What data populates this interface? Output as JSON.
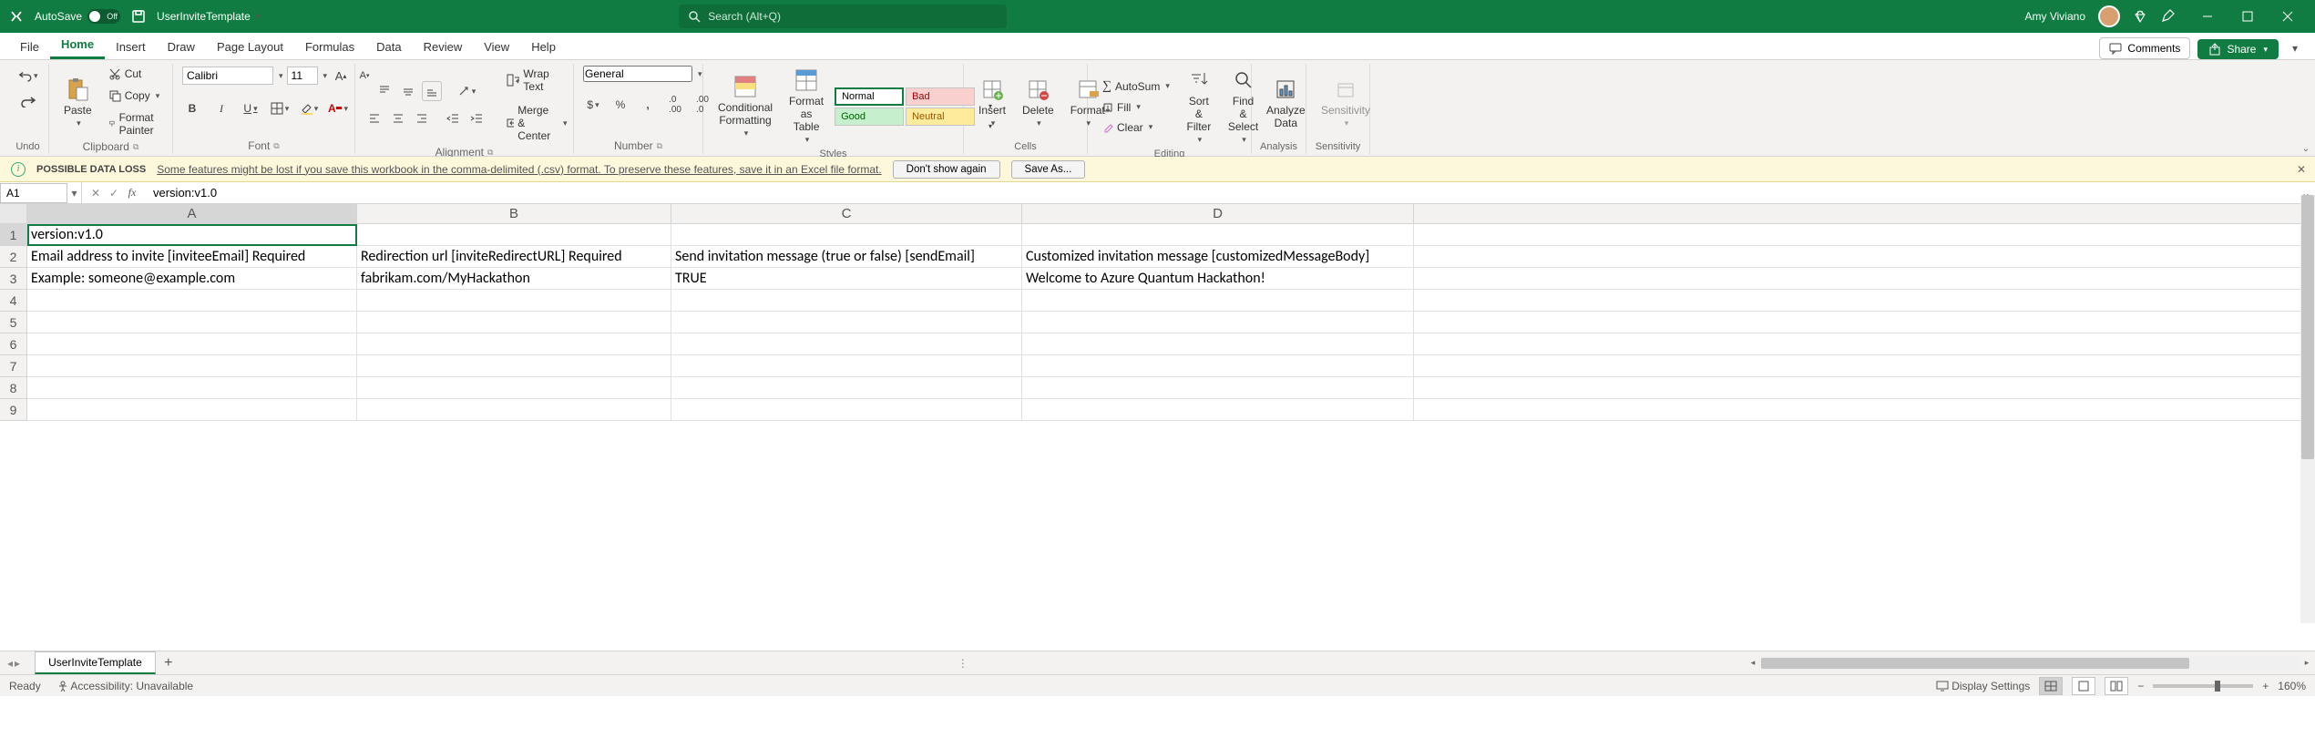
{
  "titlebar": {
    "autosave_label": "AutoSave",
    "autosave_state": "Off",
    "filename": "UserInviteTemplate",
    "search_placeholder": "Search (Alt+Q)",
    "username": "Amy Viviano"
  },
  "tabs": {
    "file": "File",
    "home": "Home",
    "insert": "Insert",
    "draw": "Draw",
    "page_layout": "Page Layout",
    "formulas": "Formulas",
    "data": "Data",
    "review": "Review",
    "view": "View",
    "help": "Help",
    "comments": "Comments",
    "share": "Share"
  },
  "ribbon": {
    "undo_label": "Undo",
    "paste": "Paste",
    "cut": "Cut",
    "copy": "Copy",
    "format_painter": "Format Painter",
    "clipboard_label": "Clipboard",
    "font_name": "Calibri",
    "font_size": "11",
    "font_label": "Font",
    "wrap_text": "Wrap Text",
    "merge_center": "Merge & Center",
    "alignment_label": "Alignment",
    "number_format": "General",
    "number_label": "Number",
    "conditional_formatting": "Conditional\nFormatting",
    "format_as_table": "Format as\nTable",
    "style_normal": "Normal",
    "style_bad": "Bad",
    "style_good": "Good",
    "style_neutral": "Neutral",
    "styles_label": "Styles",
    "insert_btn": "Insert",
    "delete_btn": "Delete",
    "format_btn": "Format",
    "cells_label": "Cells",
    "autosum": "AutoSum",
    "fill": "Fill",
    "clear": "Clear",
    "editing_label": "Editing",
    "sort_filter": "Sort &\nFilter",
    "find_select": "Find &\nSelect",
    "analyze_data": "Analyze\nData",
    "analysis_label": "Analysis",
    "sensitivity": "Sensitivity",
    "sensitivity_label": "Sensitivity"
  },
  "msgbar": {
    "title": "POSSIBLE DATA LOSS",
    "text": "Some features might be lost if you save this workbook in the comma-delimited (.csv) format. To preserve these features, save it in an Excel file format.",
    "dont_show": "Don't show again",
    "save_as": "Save As..."
  },
  "formulabar": {
    "namebox": "A1",
    "formula": "version:v1.0"
  },
  "grid": {
    "cols": [
      "A",
      "B",
      "C",
      "D"
    ],
    "rownums": [
      "1",
      "2",
      "3",
      "4",
      "5",
      "6",
      "7",
      "8",
      "9"
    ],
    "cells": {
      "A1": "version:v1.0",
      "A2": "Email address to invite [inviteeEmail] Required",
      "B2": "Redirection url [inviteRedirectURL] Required",
      "C2": "Send invitation message (true or false) [sendEmail]",
      "D2": "Customized invitation message [customizedMessageBody]",
      "A3": "Example:    someone@example.com",
      "B3": "fabrikam.com/MyHackathon",
      "C3": "TRUE",
      "D3": " Welcome to Azure Quantum Hackathon!"
    }
  },
  "sheetrow": {
    "tab": "UserInviteTemplate"
  },
  "status": {
    "ready": "Ready",
    "accessibility": "Accessibility: Unavailable",
    "display_settings": "Display Settings",
    "zoom": "160%"
  }
}
